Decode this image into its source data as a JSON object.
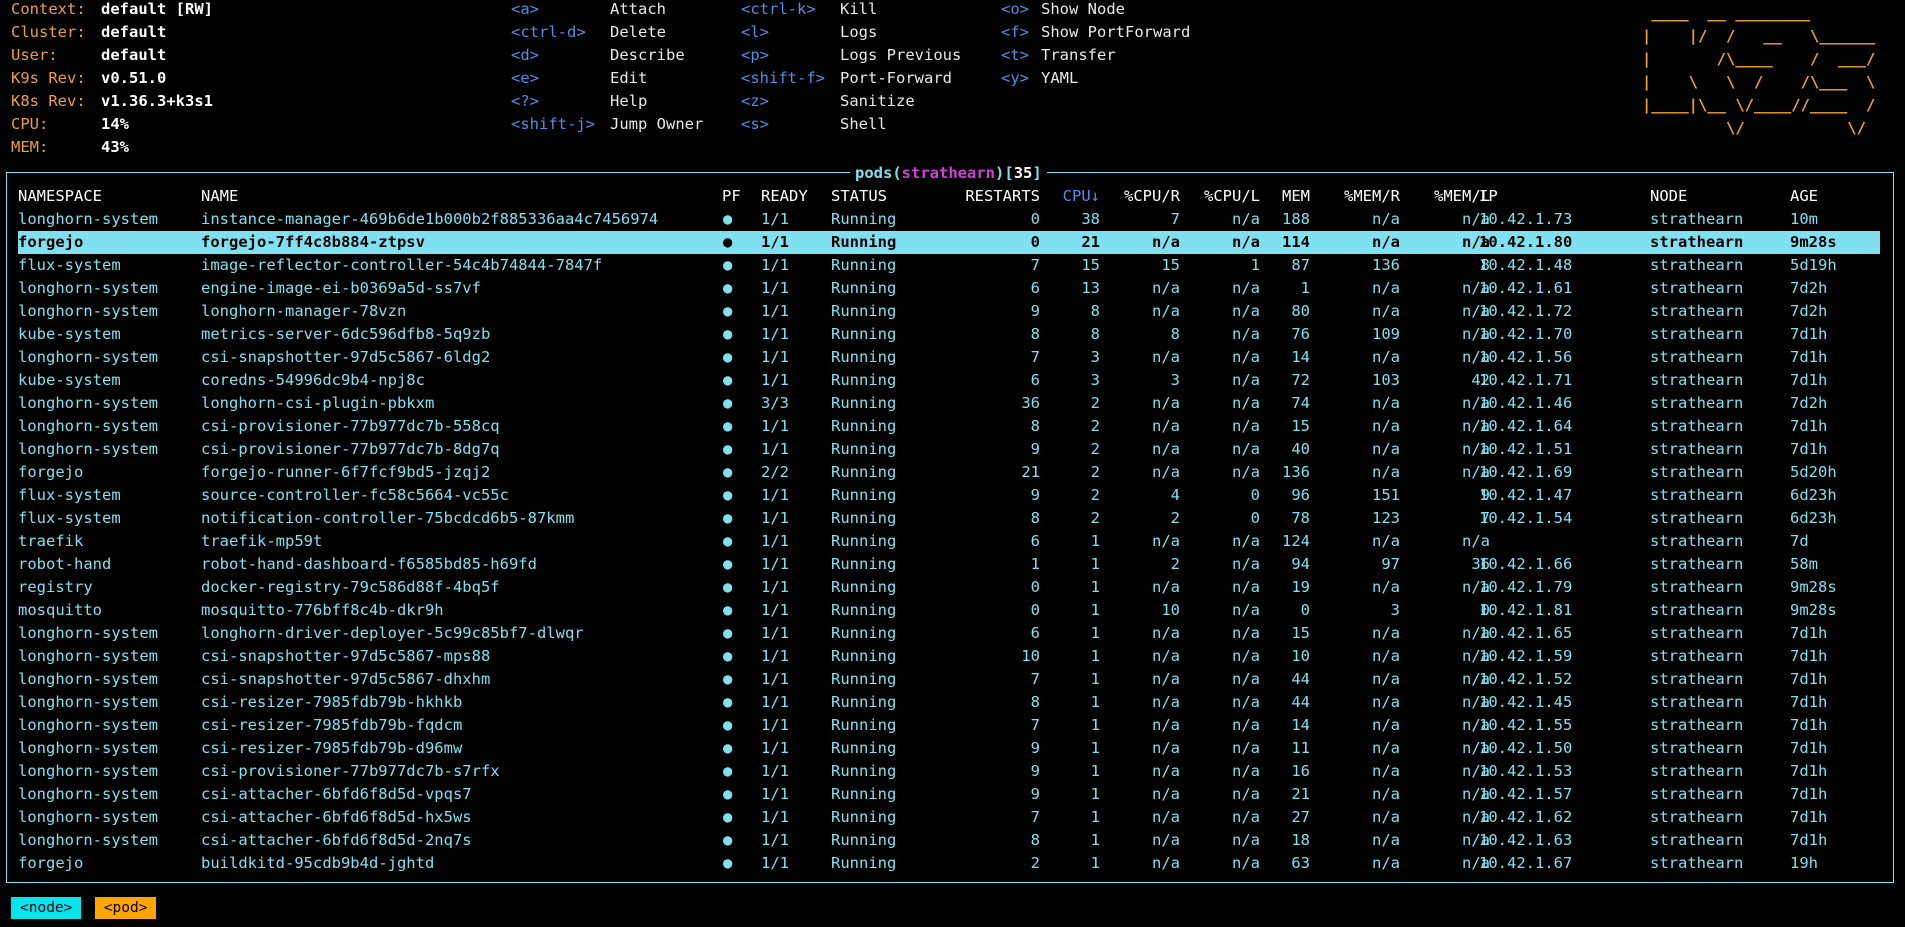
{
  "header": {
    "info": [
      {
        "label": "Context:",
        "value": "default [RW]"
      },
      {
        "label": "Cluster:",
        "value": "default"
      },
      {
        "label": "User:",
        "value": "default"
      },
      {
        "label": "K9s Rev:",
        "value": "v0.51.0"
      },
      {
        "label": "K8s Rev:",
        "value": "v1.36.3+k3s1"
      },
      {
        "label": "CPU:",
        "value": "14%"
      },
      {
        "label": "MEM:",
        "value": "43%"
      }
    ],
    "shortcuts": [
      [
        {
          "key": "<a>",
          "action": "Attach"
        },
        {
          "key": "<ctrl-d>",
          "action": "Delete"
        },
        {
          "key": "<d>",
          "action": "Describe"
        },
        {
          "key": "<e>",
          "action": "Edit"
        },
        {
          "key": "<?>",
          "action": "Help"
        },
        {
          "key": "<shift-j>",
          "action": "Jump Owner"
        }
      ],
      [
        {
          "key": "<ctrl-k>",
          "action": "Kill"
        },
        {
          "key": "<l>",
          "action": "Logs"
        },
        {
          "key": "<p>",
          "action": "Logs Previous"
        },
        {
          "key": "<shift-f>",
          "action": "Port-Forward"
        },
        {
          "key": "<z>",
          "action": "Sanitize"
        },
        {
          "key": "<s>",
          "action": "Shell"
        }
      ],
      [
        {
          "key": "<o>",
          "action": "Show Node"
        },
        {
          "key": "<f>",
          "action": "Show PortForward"
        },
        {
          "key": "<t>",
          "action": "Transfer"
        },
        {
          "key": "<y>",
          "action": "YAML"
        }
      ]
    ],
    "logo": [
      " ____  __ ________       ",
      "|    |/  /   __   \\______",
      "|       /\\____    /  ___/",
      "|    \\   \\  /    /\\___  \\",
      "|____|\\__ \\/____//____  /",
      "         \\/           \\/ "
    ]
  },
  "table": {
    "resource": "pods",
    "context": "strathearn",
    "count": "35",
    "columns": [
      "NAMESPACE",
      "NAME",
      "PF",
      "READY",
      "STATUS",
      "RESTARTS",
      "CPU",
      "%CPU/R",
      "%CPU/L",
      "MEM",
      "%MEM/R",
      "%MEM/L",
      "IP",
      "NODE",
      "AGE"
    ],
    "sort_indicator": "↓",
    "selected_index": 1,
    "rows": [
      [
        "longhorn-system",
        "instance-manager-469b6de1b000b2f885336aa4c7456974",
        "●",
        "1/1",
        "Running",
        "0",
        "38",
        "7",
        "n/a",
        "188",
        "n/a",
        "n/a",
        "10.42.1.73",
        "strathearn",
        "10m"
      ],
      [
        "forgejo",
        "forgejo-7ff4c8b884-ztpsv",
        "●",
        "1/1",
        "Running",
        "0",
        "21",
        "n/a",
        "n/a",
        "114",
        "n/a",
        "n/a",
        "10.42.1.80",
        "strathearn",
        "9m28s"
      ],
      [
        "flux-system",
        "image-reflector-controller-54c4b74844-7847f",
        "●",
        "1/1",
        "Running",
        "7",
        "15",
        "15",
        "1",
        "87",
        "136",
        "8",
        "10.42.1.48",
        "strathearn",
        "5d19h"
      ],
      [
        "longhorn-system",
        "engine-image-ei-b0369a5d-ss7vf",
        "●",
        "1/1",
        "Running",
        "6",
        "13",
        "n/a",
        "n/a",
        "1",
        "n/a",
        "n/a",
        "10.42.1.61",
        "strathearn",
        "7d2h"
      ],
      [
        "longhorn-system",
        "longhorn-manager-78vzn",
        "●",
        "1/1",
        "Running",
        "9",
        "8",
        "n/a",
        "n/a",
        "80",
        "n/a",
        "n/a",
        "10.42.1.72",
        "strathearn",
        "7d2h"
      ],
      [
        "kube-system",
        "metrics-server-6dc596dfb8-5q9zb",
        "●",
        "1/1",
        "Running",
        "8",
        "8",
        "8",
        "n/a",
        "76",
        "109",
        "n/a",
        "10.42.1.70",
        "strathearn",
        "7d1h"
      ],
      [
        "longhorn-system",
        "csi-snapshotter-97d5c5867-6ldg2",
        "●",
        "1/1",
        "Running",
        "7",
        "3",
        "n/a",
        "n/a",
        "14",
        "n/a",
        "n/a",
        "10.42.1.56",
        "strathearn",
        "7d1h"
      ],
      [
        "kube-system",
        "coredns-54996dc9b4-npj8c",
        "●",
        "1/1",
        "Running",
        "6",
        "3",
        "3",
        "n/a",
        "72",
        "103",
        "42",
        "10.42.1.71",
        "strathearn",
        "7d1h"
      ],
      [
        "longhorn-system",
        "longhorn-csi-plugin-pbkxm",
        "●",
        "3/3",
        "Running",
        "36",
        "2",
        "n/a",
        "n/a",
        "74",
        "n/a",
        "n/a",
        "10.42.1.46",
        "strathearn",
        "7d2h"
      ],
      [
        "longhorn-system",
        "csi-provisioner-77b977dc7b-558cq",
        "●",
        "1/1",
        "Running",
        "8",
        "2",
        "n/a",
        "n/a",
        "15",
        "n/a",
        "n/a",
        "10.42.1.64",
        "strathearn",
        "7d1h"
      ],
      [
        "longhorn-system",
        "csi-provisioner-77b977dc7b-8dg7q",
        "●",
        "1/1",
        "Running",
        "9",
        "2",
        "n/a",
        "n/a",
        "40",
        "n/a",
        "n/a",
        "10.42.1.51",
        "strathearn",
        "7d1h"
      ],
      [
        "forgejo",
        "forgejo-runner-6f7fcf9bd5-jzqj2",
        "●",
        "2/2",
        "Running",
        "21",
        "2",
        "n/a",
        "n/a",
        "136",
        "n/a",
        "n/a",
        "10.42.1.69",
        "strathearn",
        "5d20h"
      ],
      [
        "flux-system",
        "source-controller-fc58c5664-vc55c",
        "●",
        "1/1",
        "Running",
        "9",
        "2",
        "4",
        "0",
        "96",
        "151",
        "9",
        "10.42.1.47",
        "strathearn",
        "6d23h"
      ],
      [
        "flux-system",
        "notification-controller-75bcdcd6b5-87kmm",
        "●",
        "1/1",
        "Running",
        "8",
        "2",
        "2",
        "0",
        "78",
        "123",
        "7",
        "10.42.1.54",
        "strathearn",
        "6d23h"
      ],
      [
        "traefik",
        "traefik-mp59t",
        "●",
        "1/1",
        "Running",
        "6",
        "1",
        "n/a",
        "n/a",
        "124",
        "n/a",
        "n/a",
        "",
        "strathearn",
        "7d"
      ],
      [
        "robot-hand",
        "robot-hand-dashboard-f6585bd85-h69fd",
        "●",
        "1/1",
        "Running",
        "1",
        "1",
        "2",
        "n/a",
        "94",
        "97",
        "36",
        "10.42.1.66",
        "strathearn",
        "58m"
      ],
      [
        "registry",
        "docker-registry-79c586d88f-4bq5f",
        "●",
        "1/1",
        "Running",
        "0",
        "1",
        "n/a",
        "n/a",
        "19",
        "n/a",
        "n/a",
        "10.42.1.79",
        "strathearn",
        "9m28s"
      ],
      [
        "mosquitto",
        "mosquitto-776bff8c4b-dkr9h",
        "●",
        "1/1",
        "Running",
        "0",
        "1",
        "10",
        "n/a",
        "0",
        "3",
        "0",
        "10.42.1.81",
        "strathearn",
        "9m28s"
      ],
      [
        "longhorn-system",
        "longhorn-driver-deployer-5c99c85bf7-dlwqr",
        "●",
        "1/1",
        "Running",
        "6",
        "1",
        "n/a",
        "n/a",
        "15",
        "n/a",
        "n/a",
        "10.42.1.65",
        "strathearn",
        "7d1h"
      ],
      [
        "longhorn-system",
        "csi-snapshotter-97d5c5867-mps88",
        "●",
        "1/1",
        "Running",
        "10",
        "1",
        "n/a",
        "n/a",
        "10",
        "n/a",
        "n/a",
        "10.42.1.59",
        "strathearn",
        "7d1h"
      ],
      [
        "longhorn-system",
        "csi-snapshotter-97d5c5867-dhxhm",
        "●",
        "1/1",
        "Running",
        "7",
        "1",
        "n/a",
        "n/a",
        "44",
        "n/a",
        "n/a",
        "10.42.1.52",
        "strathearn",
        "7d1h"
      ],
      [
        "longhorn-system",
        "csi-resizer-7985fdb79b-hkhkb",
        "●",
        "1/1",
        "Running",
        "8",
        "1",
        "n/a",
        "n/a",
        "44",
        "n/a",
        "n/a",
        "10.42.1.45",
        "strathearn",
        "7d1h"
      ],
      [
        "longhorn-system",
        "csi-resizer-7985fdb79b-fqdcm",
        "●",
        "1/1",
        "Running",
        "7",
        "1",
        "n/a",
        "n/a",
        "14",
        "n/a",
        "n/a",
        "10.42.1.55",
        "strathearn",
        "7d1h"
      ],
      [
        "longhorn-system",
        "csi-resizer-7985fdb79b-d96mw",
        "●",
        "1/1",
        "Running",
        "9",
        "1",
        "n/a",
        "n/a",
        "11",
        "n/a",
        "n/a",
        "10.42.1.50",
        "strathearn",
        "7d1h"
      ],
      [
        "longhorn-system",
        "csi-provisioner-77b977dc7b-s7rfx",
        "●",
        "1/1",
        "Running",
        "9",
        "1",
        "n/a",
        "n/a",
        "16",
        "n/a",
        "n/a",
        "10.42.1.53",
        "strathearn",
        "7d1h"
      ],
      [
        "longhorn-system",
        "csi-attacher-6bfd6f8d5d-vpqs7",
        "●",
        "1/1",
        "Running",
        "9",
        "1",
        "n/a",
        "n/a",
        "21",
        "n/a",
        "n/a",
        "10.42.1.57",
        "strathearn",
        "7d1h"
      ],
      [
        "longhorn-system",
        "csi-attacher-6bfd6f8d5d-hx5ws",
        "●",
        "1/1",
        "Running",
        "7",
        "1",
        "n/a",
        "n/a",
        "27",
        "n/a",
        "n/a",
        "10.42.1.62",
        "strathearn",
        "7d1h"
      ],
      [
        "longhorn-system",
        "csi-attacher-6bfd6f8d5d-2nq7s",
        "●",
        "1/1",
        "Running",
        "8",
        "1",
        "n/a",
        "n/a",
        "18",
        "n/a",
        "n/a",
        "10.42.1.63",
        "strathearn",
        "7d1h"
      ],
      [
        "forgejo",
        "buildkitd-95cdb9b4d-jghtd",
        "●",
        "1/1",
        "Running",
        "2",
        "1",
        "n/a",
        "n/a",
        "63",
        "n/a",
        "n/a",
        "10.42.1.67",
        "strathearn",
        "19h"
      ]
    ]
  },
  "breadcrumbs": [
    {
      "label": "<node>",
      "color": "#00e5ee"
    },
    {
      "label": "<pod>",
      "color": "#ffa500"
    }
  ],
  "colors": {
    "label": "#f0a030",
    "key": "#4a90e8",
    "row": "#7fe0f0",
    "selection_bg": "#7fe0f0",
    "context": "#d040d8"
  }
}
